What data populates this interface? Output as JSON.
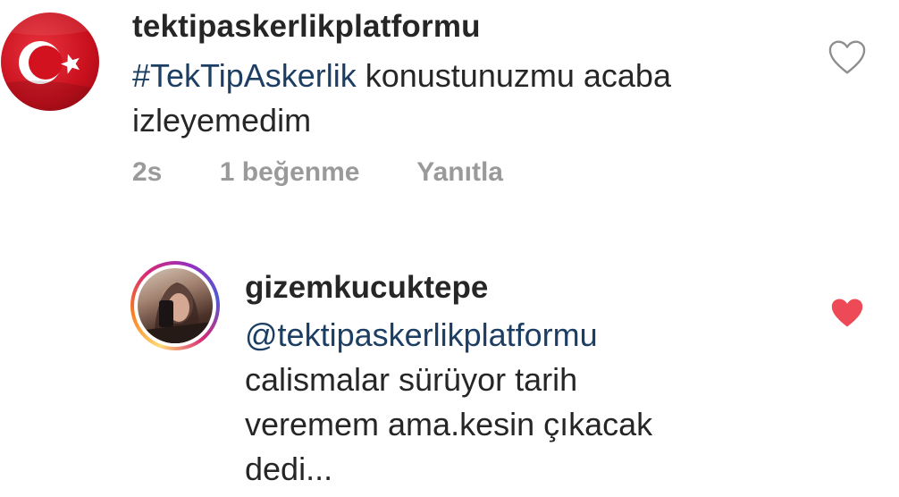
{
  "comments": [
    {
      "username": "tektipaskerlikplatformu",
      "hashtag": "#TekTipAskerlik",
      "text_line1": " konustunuzmu acaba",
      "text_line2": "izleyemedim",
      "time": "2s",
      "likes": "1 beğenme",
      "reply_label": "Yanıtla",
      "liked": false
    },
    {
      "username": "gizemkucuktepe",
      "mention": "@tektipaskerlikplatformu",
      "text_line1": "calismalar sürüyor tarih",
      "text_line2": "veremem ama.kesin çıkacak",
      "text_line3": "dedi...",
      "liked": true
    }
  ],
  "colors": {
    "link": "#1d3e63",
    "meta": "#9a9a9a",
    "liked_heart": "#ed4956",
    "unliked_heart": "#8e8e8e"
  }
}
